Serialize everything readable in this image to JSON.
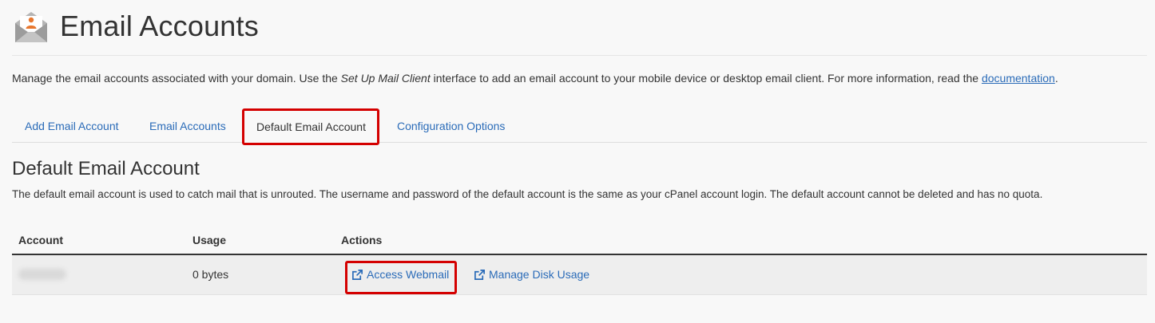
{
  "header": {
    "title": "Email Accounts",
    "icon": "email-envelope-icon"
  },
  "description": {
    "part1": "Manage the email accounts associated with your domain. Use the ",
    "emphasis": "Set Up Mail Client",
    "part2": " interface to add an email account to your mobile device or desktop email client. For more information, read the ",
    "link": "documentation",
    "end": "."
  },
  "tabs": [
    {
      "label": "Add Email Account",
      "active": false
    },
    {
      "label": "Email Accounts",
      "active": false
    },
    {
      "label": "Default Email Account",
      "active": true
    },
    {
      "label": "Configuration Options",
      "active": false
    }
  ],
  "section": {
    "title": "Default Email Account",
    "description": "The default email account is used to catch mail that is unrouted. The username and password of the default account is the same as your cPanel account login. The default account cannot be deleted and has no quota."
  },
  "table": {
    "headers": {
      "account": "Account",
      "usage": "Usage",
      "actions": "Actions"
    },
    "rows": [
      {
        "account": "",
        "usage": "0 bytes",
        "actions": [
          {
            "label": "Access Webmail",
            "icon": "external-link-icon"
          },
          {
            "label": "Manage Disk Usage",
            "icon": "external-link-icon"
          }
        ]
      }
    ]
  },
  "colors": {
    "link": "#2a6bb8",
    "highlight": "#d40000",
    "icon_accent": "#e8772e",
    "icon_envelope": "#b0b0b0"
  }
}
